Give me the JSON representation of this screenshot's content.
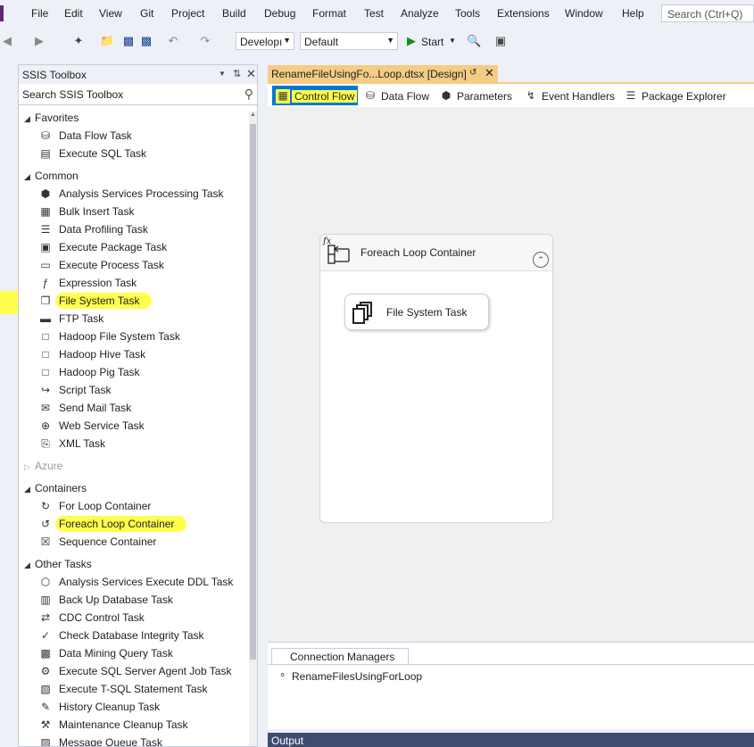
{
  "menu": {
    "items": [
      "File",
      "Edit",
      "View",
      "Git",
      "Project",
      "Build",
      "Debug",
      "Format",
      "Test",
      "Analyze",
      "Tools",
      "Extensions",
      "Window",
      "Help"
    ],
    "search_placeholder": "Search (Ctrl+Q)"
  },
  "toolbar": {
    "configuration": "Developı",
    "platform": "Default",
    "start_label": "Start"
  },
  "toolbox": {
    "title": "SSIS Toolbox",
    "search_placeholder": "Search SSIS Toolbox",
    "groups": [
      {
        "label": "Favorites",
        "expanded": true,
        "items": [
          {
            "label": "Data Flow Task",
            "icon": "data-flow-icon"
          },
          {
            "label": "Execute SQL Task",
            "icon": "execute-sql-icon"
          }
        ]
      },
      {
        "label": "Common",
        "expanded": true,
        "items": [
          {
            "label": "Analysis Services Processing Task",
            "icon": "cube-icon"
          },
          {
            "label": "Bulk Insert Task",
            "icon": "bulk-insert-icon"
          },
          {
            "label": "Data Profiling Task",
            "icon": "profiling-icon"
          },
          {
            "label": "Execute Package Task",
            "icon": "package-icon"
          },
          {
            "label": "Execute Process Task",
            "icon": "process-icon"
          },
          {
            "label": "Expression Task",
            "icon": "fx-icon"
          },
          {
            "label": "File System Task",
            "icon": "file-system-icon",
            "highlighted": true
          },
          {
            "label": "FTP Task",
            "icon": "ftp-icon"
          },
          {
            "label": "Hadoop File System Task",
            "icon": "hdfs-icon"
          },
          {
            "label": "Hadoop Hive Task",
            "icon": "hive-icon"
          },
          {
            "label": "Hadoop Pig Task",
            "icon": "pig-icon"
          },
          {
            "label": "Script Task",
            "icon": "script-icon"
          },
          {
            "label": "Send Mail Task",
            "icon": "mail-icon"
          },
          {
            "label": "Web Service Task",
            "icon": "web-service-icon"
          },
          {
            "label": "XML Task",
            "icon": "xml-icon"
          }
        ]
      },
      {
        "label": "Azure",
        "expanded": false,
        "items": []
      },
      {
        "label": "Containers",
        "expanded": true,
        "items": [
          {
            "label": "For Loop Container",
            "icon": "for-loop-icon"
          },
          {
            "label": "Foreach Loop Container",
            "icon": "foreach-loop-icon",
            "highlighted": true
          },
          {
            "label": "Sequence Container",
            "icon": "sequence-icon"
          }
        ]
      },
      {
        "label": "Other Tasks",
        "expanded": true,
        "items": [
          {
            "label": "Analysis Services Execute DDL Task",
            "icon": "ddl-icon"
          },
          {
            "label": "Back Up Database Task",
            "icon": "backup-icon"
          },
          {
            "label": "CDC Control Task",
            "icon": "cdc-icon"
          },
          {
            "label": "Check Database Integrity Task",
            "icon": "integrity-icon"
          },
          {
            "label": "Data Mining Query Task",
            "icon": "mining-icon"
          },
          {
            "label": "Execute SQL Server Agent Job Task",
            "icon": "agent-job-icon"
          },
          {
            "label": "Execute T-SQL Statement Task",
            "icon": "tsql-icon"
          },
          {
            "label": "History Cleanup Task",
            "icon": "history-icon"
          },
          {
            "label": "Maintenance Cleanup Task",
            "icon": "maintenance-icon"
          },
          {
            "label": "Message Queue Task",
            "icon": "queue-icon"
          }
        ]
      }
    ]
  },
  "document": {
    "tab_title": "RenameFileUsingFo...Loop.dtsx [Design]",
    "designer_tabs": [
      "Control Flow",
      "Data Flow",
      "Parameters",
      "Event Handlers",
      "Package Explorer"
    ],
    "active_tab": "Control Flow"
  },
  "canvas": {
    "container_title": "Foreach Loop Container",
    "task_label": "File System Task"
  },
  "connections": {
    "tab_label": "Connection Managers",
    "items": [
      "RenameFilesUsingForLoop"
    ]
  },
  "output": {
    "title": "Output"
  },
  "colors": {
    "highlight": "#ffff4d",
    "tab_accent": "#f5cc84",
    "active_tab": "#0078d4",
    "output_bar": "#3f4b71"
  }
}
